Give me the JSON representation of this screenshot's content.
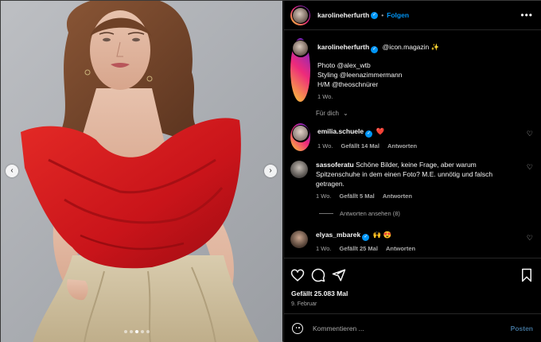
{
  "header": {
    "username": "karolineherfurth",
    "verified_icon": "verified-badge-icon",
    "follow_label": "Folgen",
    "separator": "•",
    "more_icon": "more-options-icon"
  },
  "caption": {
    "username": "karolineherfurth",
    "mention": "@icon.magazin",
    "mention_emoji": "✨",
    "lines": [
      "Photo @alex_wtb",
      "Styling @leenazimmermann",
      "H/M @theoschnürer"
    ],
    "time": "1 Wo."
  },
  "for_you": "Für dich",
  "comments": [
    {
      "username": "emilia.schuele",
      "text": "",
      "emoji": "❤️",
      "time": "1 Wo.",
      "likes": "Gefällt 14 Mal",
      "reply": "Antworten"
    },
    {
      "username": "sassoferatu",
      "text": "Schöne Bilder, keine Frage, aber warum Spitzenschuhe in dem einen Foto? M.E. unnötig und falsch getragen.",
      "time": "1 Wo.",
      "likes": "Gefällt 5 Mal",
      "reply": "Antworten"
    },
    {
      "username": "elyas_mbarek",
      "text": "",
      "emoji": "🙌 😍",
      "time": "1 Wo.",
      "likes": "Gefällt 25 Mal",
      "reply": "Antworten"
    }
  ],
  "view_replies": "Antworten ansehen (8)",
  "post": {
    "likes": "Gefällt 25.083 Mal",
    "date": "9. Februar"
  },
  "compose": {
    "placeholder": "Kommentieren ...",
    "post_label": "Posten"
  },
  "carousel": {
    "prev": "‹",
    "next": "›",
    "dot_count": 5,
    "active_dot": 2
  },
  "colors": {
    "accent": "#0095f6",
    "background": "#000000",
    "muted": "#a8a8a8",
    "dress_red": "#d4171b",
    "skirt_beige": "#d8cdb0"
  }
}
